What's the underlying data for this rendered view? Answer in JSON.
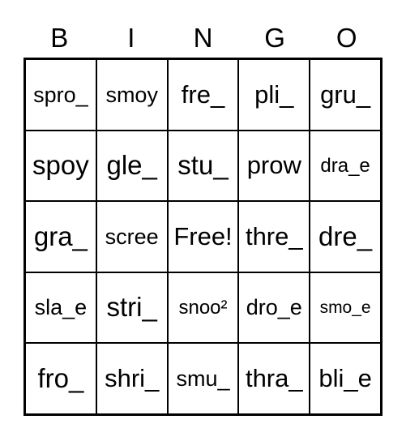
{
  "card": {
    "headers": [
      "B",
      "I",
      "N",
      "G",
      "O"
    ],
    "rows": [
      {
        "cells": [
          {
            "text": "spro_",
            "size": "md"
          },
          {
            "text": "smoy",
            "size": "md"
          },
          {
            "text": "fre_",
            "size": "lg"
          },
          {
            "text": "pli_",
            "size": "lg"
          },
          {
            "text": "gru_",
            "size": "lg"
          }
        ]
      },
      {
        "cells": [
          {
            "text": "spoy",
            "size": "xl"
          },
          {
            "text": "gle_",
            "size": "xl"
          },
          {
            "text": "stu_",
            "size": "xl"
          },
          {
            "text": "prow",
            "size": "lg"
          },
          {
            "text": "dra_e",
            "size": "sm"
          }
        ]
      },
      {
        "cells": [
          {
            "text": "gra_",
            "size": "xl"
          },
          {
            "text": "scree",
            "size": "md"
          },
          {
            "text": "Free!",
            "size": "lg"
          },
          {
            "text": "thre_",
            "size": "lg"
          },
          {
            "text": "dre_",
            "size": "xl"
          }
        ]
      },
      {
        "cells": [
          {
            "text": "sla_e",
            "size": "md"
          },
          {
            "text": "stri_",
            "size": "xl"
          },
          {
            "text": "snoo²",
            "size": "sm"
          },
          {
            "text": "dro_e",
            "size": "md"
          },
          {
            "text": "smo_e",
            "size": "xs"
          }
        ]
      },
      {
        "cells": [
          {
            "text": "fro_",
            "size": "xl"
          },
          {
            "text": "shri_",
            "size": "lg"
          },
          {
            "text": "smu_",
            "size": "md"
          },
          {
            "text": "thra_",
            "size": "lg"
          },
          {
            "text": "bli_e",
            "size": "lg"
          }
        ]
      }
    ],
    "colors": {
      "background": "#ffffff",
      "border": "#000000",
      "text": "#000000"
    }
  }
}
